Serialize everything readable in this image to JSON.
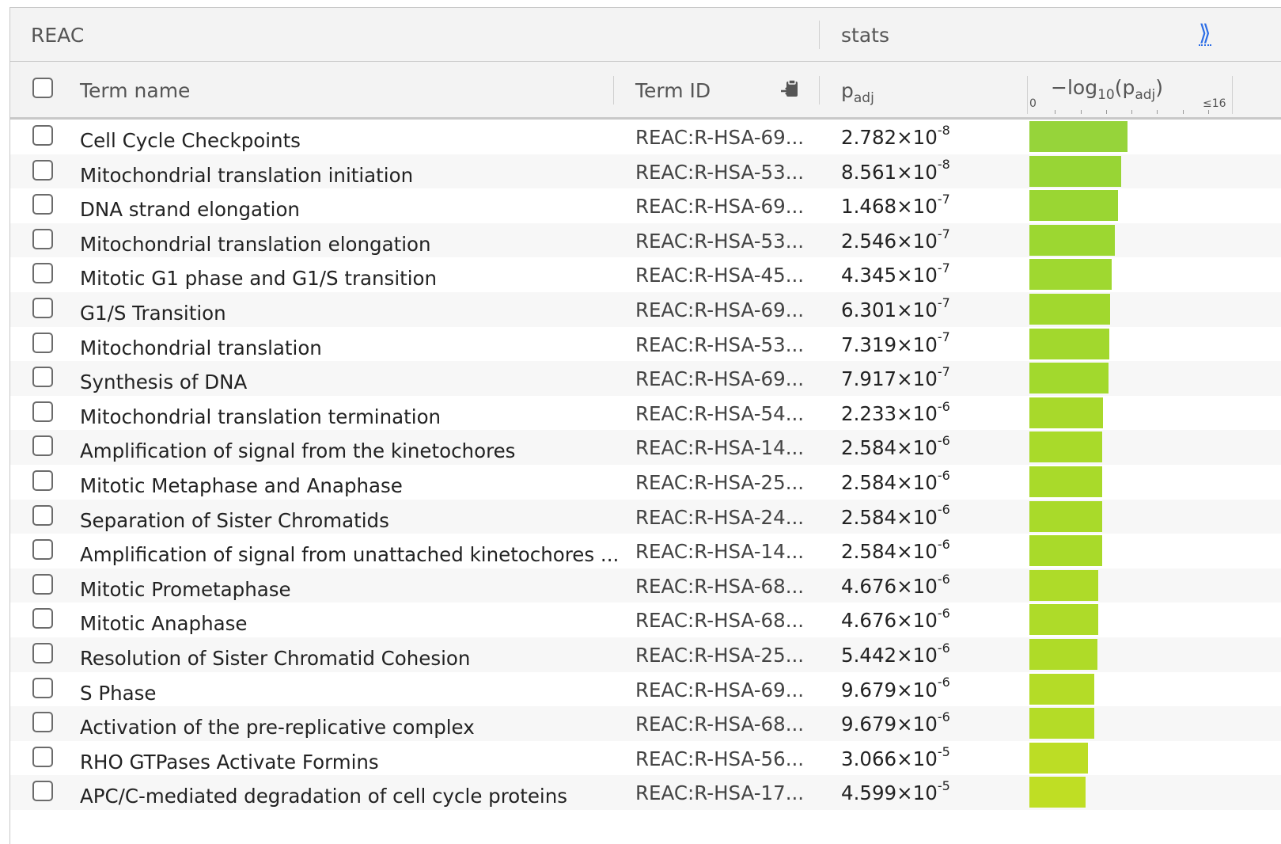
{
  "header": {
    "source": "REAC",
    "stats": "stats",
    "expand_glyph": "⟫"
  },
  "columns": {
    "term_name": "Term name",
    "term_id": "Term ID",
    "padj_base": "p",
    "padj_sub": "adj",
    "neglog_prefix": "−log",
    "neglog_base": "10",
    "neglog_open": "(p",
    "neglog_sub": "adj",
    "neglog_close": ")",
    "axis_min": "0",
    "axis_max": "≤16",
    "axis_max_value": 16
  },
  "icons": {
    "copy": "clipboard-copy-icon"
  },
  "rows": [
    {
      "name": "Cell Cycle Checkpoints",
      "id": "REAC:R-HSA-69...",
      "mant": "2.782",
      "exp": "-8",
      "neglog": 7.56,
      "color": "#96d43a"
    },
    {
      "name": "Mitochondrial translation initiation",
      "id": "REAC:R-HSA-53...",
      "mant": "8.561",
      "exp": "-8",
      "neglog": 7.07,
      "color": "#98d535"
    },
    {
      "name": "DNA strand elongation",
      "id": "REAC:R-HSA-69...",
      "mant": "1.468",
      "exp": "-7",
      "neglog": 6.83,
      "color": "#9ad633"
    },
    {
      "name": "Mitochondrial translation elongation",
      "id": "REAC:R-HSA-53...",
      "mant": "2.546",
      "exp": "-7",
      "neglog": 6.59,
      "color": "#9cd731"
    },
    {
      "name": "Mitotic G1 phase and G1/S transition",
      "id": "REAC:R-HSA-45...",
      "mant": "4.345",
      "exp": "-7",
      "neglog": 6.36,
      "color": "#9fd830"
    },
    {
      "name": "G1/S Transition",
      "id": "REAC:R-HSA-69...",
      "mant": "6.301",
      "exp": "-7",
      "neglog": 6.2,
      "color": "#a1d82e"
    },
    {
      "name": "Mitochondrial translation",
      "id": "REAC:R-HSA-53...",
      "mant": "7.319",
      "exp": "-7",
      "neglog": 6.14,
      "color": "#a2d82d"
    },
    {
      "name": "Synthesis of DNA",
      "id": "REAC:R-HSA-69...",
      "mant": "7.917",
      "exp": "-7",
      "neglog": 6.1,
      "color": "#a2d92d"
    },
    {
      "name": "Mitochondrial translation termination",
      "id": "REAC:R-HSA-54...",
      "mant": "2.233",
      "exp": "-6",
      "neglog": 5.65,
      "color": "#a8d92b"
    },
    {
      "name": "Amplification of signal from the kinetochores",
      "id": "REAC:R-HSA-14...",
      "mant": "2.584",
      "exp": "-6",
      "neglog": 5.59,
      "color": "#a9da2a"
    },
    {
      "name": "Mitotic Metaphase and Anaphase",
      "id": "REAC:R-HSA-25...",
      "mant": "2.584",
      "exp": "-6",
      "neglog": 5.59,
      "color": "#a9da2a"
    },
    {
      "name": "Separation of Sister Chromatids",
      "id": "REAC:R-HSA-24...",
      "mant": "2.584",
      "exp": "-6",
      "neglog": 5.59,
      "color": "#a9da2a"
    },
    {
      "name": "Amplification of signal from unattached kinetochores ...",
      "id": "REAC:R-HSA-14...",
      "mant": "2.584",
      "exp": "-6",
      "neglog": 5.59,
      "color": "#a9da2a"
    },
    {
      "name": "Mitotic Prometaphase",
      "id": "REAC:R-HSA-68...",
      "mant": "4.676",
      "exp": "-6",
      "neglog": 5.33,
      "color": "#aedb29"
    },
    {
      "name": "Mitotic Anaphase",
      "id": "REAC:R-HSA-68...",
      "mant": "4.676",
      "exp": "-6",
      "neglog": 5.33,
      "color": "#aedb29"
    },
    {
      "name": "Resolution of Sister Chromatid Cohesion",
      "id": "REAC:R-HSA-25...",
      "mant": "5.442",
      "exp": "-6",
      "neglog": 5.26,
      "color": "#afdb28"
    },
    {
      "name": "S Phase",
      "id": "REAC:R-HSA-69...",
      "mant": "9.679",
      "exp": "-6",
      "neglog": 5.01,
      "color": "#b4dc27"
    },
    {
      "name": "Activation of the pre-replicative complex",
      "id": "REAC:R-HSA-68...",
      "mant": "9.679",
      "exp": "-6",
      "neglog": 5.01,
      "color": "#b4dc27"
    },
    {
      "name": "RHO GTPases Activate Formins",
      "id": "REAC:R-HSA-56...",
      "mant": "3.066",
      "exp": "-5",
      "neglog": 4.51,
      "color": "#bcdd25"
    },
    {
      "name": "APC/C-mediated degradation of cell cycle proteins",
      "id": "REAC:R-HSA-17...",
      "mant": "4.599",
      "exp": "-5",
      "neglog": 4.34,
      "color": "#bfde24"
    }
  ]
}
